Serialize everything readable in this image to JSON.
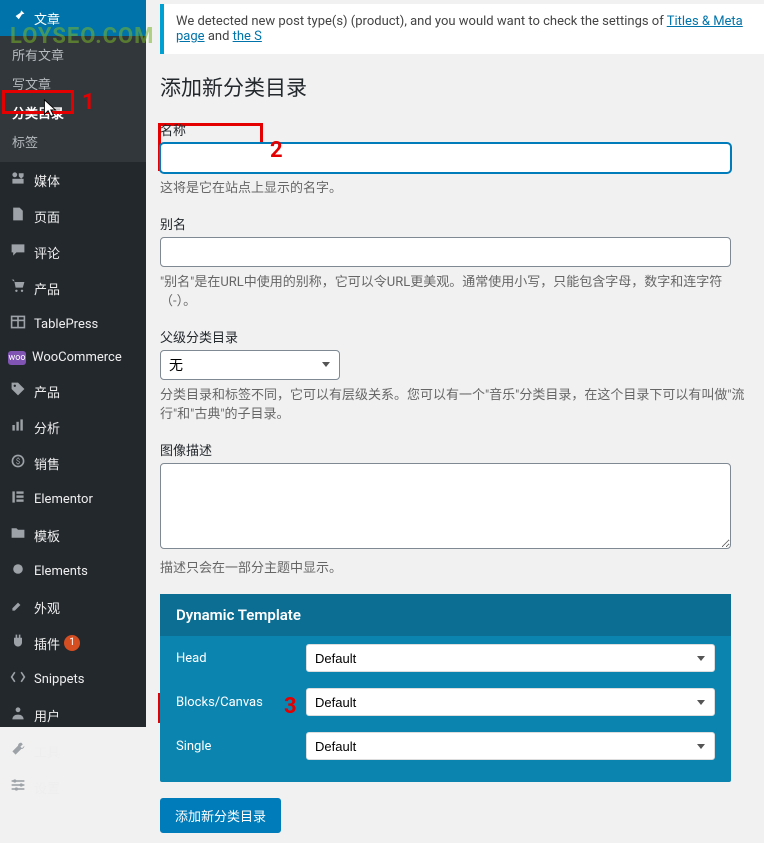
{
  "watermark": "LOYSEO.COM",
  "sidebar": {
    "active": {
      "icon": "push-pin",
      "label": "文章"
    },
    "submenu": [
      "所有文章",
      "写文章",
      "分类目录",
      "标签"
    ],
    "submenu_current": "分类目录",
    "items": [
      {
        "icon": "media",
        "label": "媒体"
      },
      {
        "icon": "page",
        "label": "页面"
      },
      {
        "icon": "comments",
        "label": "评论"
      },
      {
        "icon": "products",
        "label": "产品"
      },
      {
        "icon": "table",
        "label": "TablePress"
      },
      {
        "icon": "woo",
        "label": "WooCommerce"
      },
      {
        "icon": "products2",
        "label": "产品"
      },
      {
        "icon": "analytics",
        "label": "分析"
      },
      {
        "icon": "sales",
        "label": "销售"
      },
      {
        "icon": "elementor",
        "label": "Elementor"
      },
      {
        "icon": "templates",
        "label": "模板"
      },
      {
        "icon": "elements",
        "label": "Elements"
      },
      {
        "icon": "appearance",
        "label": "外观"
      },
      {
        "icon": "plugins",
        "label": "插件",
        "badge": "1"
      },
      {
        "icon": "snippets",
        "label": "Snippets"
      },
      {
        "icon": "users",
        "label": "用户"
      },
      {
        "icon": "tools",
        "label": "工具"
      },
      {
        "icon": "settings",
        "label": "设置"
      }
    ]
  },
  "notice": {
    "text_before": "We detected new post type(s) (product), and you would want to check the settings of ",
    "link1": "Titles & Meta page",
    "text_mid": " and ",
    "link2": "the S"
  },
  "heading": "添加新分类目录",
  "fields": {
    "name": {
      "label": "名称",
      "desc": "这将是它在站点上显示的名字。"
    },
    "slug": {
      "label": "别名",
      "desc": "\"别名\"是在URL中使用的别称，它可以令URL更美观。通常使用小写，只能包含字母，数字和连字符（-）。"
    },
    "parent": {
      "label": "父级分类目录",
      "selected": "无",
      "desc": "分类目录和标签不同，它可以有层级关系。您可以有一个\"音乐\"分类目录，在这个目录下可以有叫做\"流行\"和\"古典\"的子目录。"
    },
    "description": {
      "label": "图像描述",
      "desc": "描述只会在一部分主题中显示。"
    }
  },
  "dynamic": {
    "title": "Dynamic Template",
    "rows": [
      {
        "label": "Head",
        "value": "Default"
      },
      {
        "label": "Blocks/Canvas",
        "value": "Default"
      },
      {
        "label": "Single",
        "value": "Default"
      }
    ]
  },
  "submit_label": "添加新分类目录",
  "annotations": {
    "n1": "1",
    "n2": "2",
    "n3": "3"
  }
}
